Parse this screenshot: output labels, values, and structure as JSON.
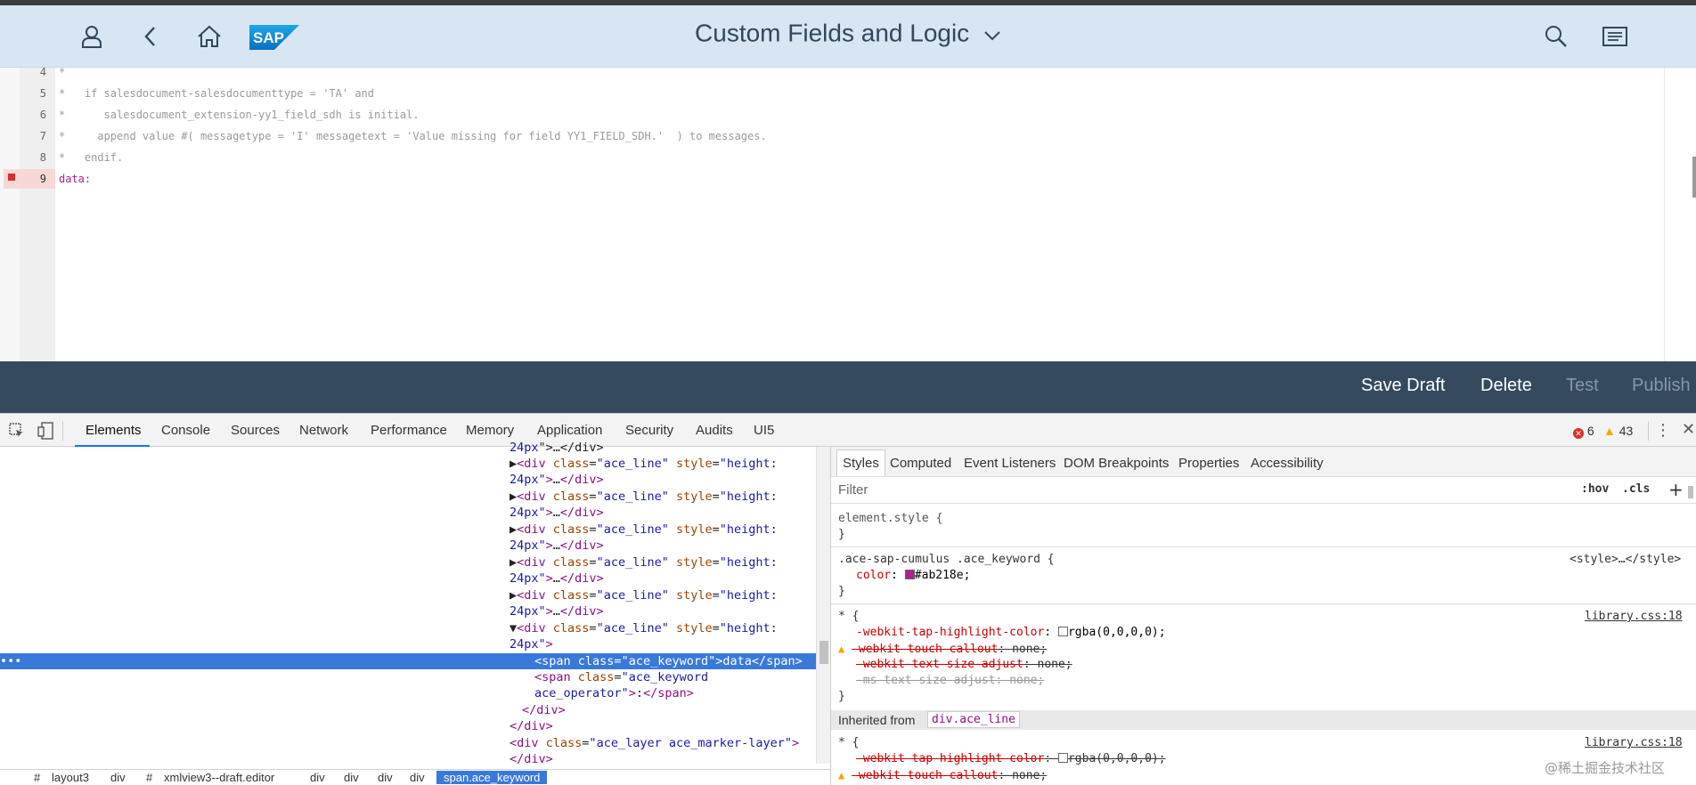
{
  "shell": {
    "title": "Custom Fields and Logic",
    "logo_text": "SAP",
    "icons": [
      "user-icon",
      "back-icon",
      "home-icon",
      "search-icon",
      "menu-icon",
      "chevron-down-icon"
    ]
  },
  "editor": {
    "lines": [
      {
        "num": "4",
        "text": "*",
        "kind": "comment"
      },
      {
        "num": "5",
        "text": "*   if salesdocument-salesdocumenttype = 'TA' and",
        "kind": "comment"
      },
      {
        "num": "6",
        "text": "*      salesdocument_extension-yy1_field_sdh is initial.",
        "kind": "comment"
      },
      {
        "num": "7",
        "text": "*     append value #( messagetype = 'I' messagetext = 'Value missing for field YY1_FIELD_SDH.'  ) to messages.",
        "kind": "comment"
      },
      {
        "num": "8",
        "text": "*   endif.",
        "kind": "comment"
      },
      {
        "num": "9",
        "text": "data:",
        "kind": "keyword",
        "error": true
      }
    ]
  },
  "footer": {
    "save_draft": "Save Draft",
    "delete": "Delete",
    "test": "Test",
    "publish": "Publish"
  },
  "devtools": {
    "tabs": [
      "Elements",
      "Console",
      "Sources",
      "Network",
      "Performance",
      "Memory",
      "Application",
      "Security",
      "Audits",
      "UI5"
    ],
    "active_tab": "Elements",
    "error_count": "6",
    "warning_count": "43",
    "dom_lines": [
      {
        "indent": "   ",
        "a": "24px\">…</div>",
        "partial": true
      },
      {
        "indent": "",
        "tag": "div",
        "cls": "ace_line",
        "style": "height:",
        "cont": "24px\">…</div>",
        "arrow": "▶"
      },
      {
        "indent": "",
        "tag": "div",
        "cls": "ace_line",
        "style": "height:",
        "cont": "24px\">…</div>",
        "arrow": "▶"
      },
      {
        "indent": "",
        "tag": "div",
        "cls": "ace_line",
        "style": "height:",
        "cont": "24px\">…</div>",
        "arrow": "▶"
      },
      {
        "indent": "",
        "tag": "div",
        "cls": "ace_line",
        "style": "height:",
        "cont": "24px\">…</div>",
        "arrow": "▶"
      },
      {
        "indent": "",
        "tag": "div",
        "cls": "ace_line",
        "style": "height:",
        "cont": "24px\">…</div>",
        "arrow": "▶"
      },
      {
        "indent": "",
        "tag": "div",
        "cls": "ace_line",
        "style": "height:",
        "cont": "24px\">",
        "arrow": "▼"
      }
    ],
    "selected_span": {
      "cls": "ace_keyword",
      "text": "data"
    },
    "span2": {
      "cls1": "ace_keyword",
      "cls2": "ace_operator",
      "text": ":"
    },
    "close_div": "</div>",
    "marker_layer": {
      "cls": "ace_layer ace_marker-layer"
    },
    "breadcrumbs": [
      "#",
      "layout3",
      "div",
      "#",
      "xmlview3--draft.editor",
      "div",
      "div",
      "div",
      "div",
      "span.ace_keyword"
    ],
    "styles": {
      "tabs": [
        "Styles",
        "Computed",
        "Event Listeners",
        "DOM Breakpoints",
        "Properties",
        "Accessibility"
      ],
      "filter_placeholder": "Filter",
      "hov": ":hov",
      "cls": ".cls",
      "element_style": "element.style {",
      "rule1_selector": ".ace-sap-cumulus .ace_keyword {",
      "rule1_source": "<style>…</style>",
      "rule1_prop": "color",
      "rule1_value": "#ab218e",
      "rule1_color": "#ab218e",
      "rule2_selector": "* {",
      "rule2_source": "library.css:18",
      "rule2_props": [
        {
          "name": "-webkit-tap-highlight-color",
          "value": "rgba(0,0,0,0)",
          "struck": false
        },
        {
          "name": "-webkit-touch-callout",
          "value": "none",
          "struck": true
        },
        {
          "name": "-webkit-text-size-adjust",
          "value": "none",
          "struck": true
        },
        {
          "name": "-ms-text-size-adjust",
          "value": "none",
          "struck": true
        }
      ],
      "inherited_label": "Inherited from",
      "inherited_from": "div.ace_line",
      "rule3_selector": "* {",
      "rule3_source": "library.css:18",
      "rule3_props": [
        {
          "name": "-webkit-tap-highlight-color",
          "value": "rgba(0,0,0,0)"
        },
        {
          "name": "-webkit-touch-callout",
          "value": "none"
        }
      ]
    }
  },
  "watermark": "@稀土掘金技术社区"
}
